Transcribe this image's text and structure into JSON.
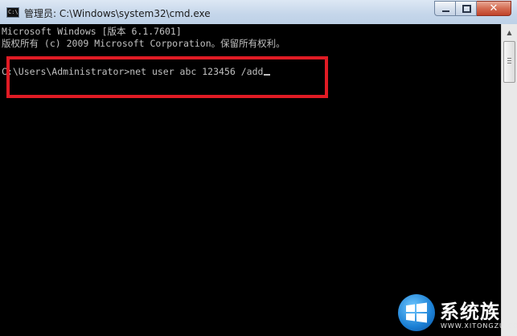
{
  "window": {
    "title": "管理员: C:\\Windows\\system32\\cmd.exe",
    "icon": "cmd-icon",
    "icon_text": "C:\\"
  },
  "controls": {
    "minimize_icon": "minimize-icon",
    "maximize_icon": "maximize-icon",
    "close_icon": "close-icon",
    "close_glyph": "✕"
  },
  "console": {
    "lines": [
      "Microsoft Windows [版本 6.1.7601]",
      "版权所有 (c) 2009 Microsoft Corporation。保留所有权利。"
    ],
    "prompt": "C:\\Users\\Administrator>",
    "command": "net user abc 123456 /add",
    "text_color": "#c0c0c0",
    "background": "#000000",
    "highlight_color": "#e01b24"
  },
  "scrollbar": {
    "up_arrow": "▲",
    "position": 0
  },
  "watermark": {
    "name": "系统族",
    "domain": "WWW.XITONGZU.COM",
    "logo": "windows-logo-icon"
  }
}
